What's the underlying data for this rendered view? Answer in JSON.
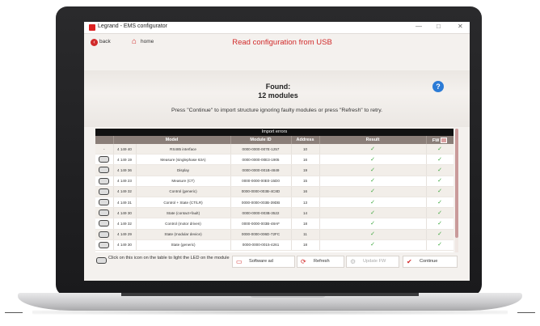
{
  "window": {
    "title": "Legrand - EMS configurator",
    "minimize": "—",
    "maximize": "□",
    "close": "✕"
  },
  "nav": {
    "back_label": "back",
    "home_label": "home",
    "page_title": "Read configuration from USB"
  },
  "found": {
    "line1": "Found:",
    "line2": "12 modules"
  },
  "instruction": "Press \"Continue\" to import structure ignoring faulty modules or press \"Refresh\" to retry.",
  "table": {
    "banner": "Import errors",
    "headers": [
      "",
      "Model",
      "Module ID",
      "Address",
      "Result",
      "FW"
    ],
    "rows": [
      {
        "led": "-",
        "ref": "4 149 40",
        "model": "RS485 interface",
        "module_id": "0000-0000-007E-1257",
        "address": "10",
        "result": "✓",
        "fw": "✓"
      },
      {
        "led": "",
        "ref": "4 149 19",
        "model": "Measure (singlephase 63A)",
        "module_id": "0000-0000-00E3-1905",
        "address": "16",
        "result": "✓",
        "fw": "✓"
      },
      {
        "led": "",
        "ref": "4 149 36",
        "model": "Display",
        "module_id": "0000-0000-001B-4849",
        "address": "19",
        "result": "✓",
        "fw": "✓"
      },
      {
        "led": "",
        "ref": "4 149 23",
        "model": "Measure (CT)",
        "module_id": "0000-0000-00E0-15D0",
        "address": "15",
        "result": "✓",
        "fw": "✓"
      },
      {
        "led": "",
        "ref": "4 149 32",
        "model": "Control (generic)",
        "module_id": "0000-0000-003B-4C8D",
        "address": "16",
        "result": "✓",
        "fw": "✓"
      },
      {
        "led": "",
        "ref": "4 149 31",
        "model": "Control + State (CT/LR)",
        "module_id": "0000-0000-003B-39DB",
        "address": "13",
        "result": "✓",
        "fw": "✓"
      },
      {
        "led": "",
        "ref": "4 149 30",
        "model": "State (contact+fault)",
        "module_id": "0000-0000-003B-3522",
        "address": "14",
        "result": "✓",
        "fw": "✓"
      },
      {
        "led": "",
        "ref": "4 149 32",
        "model": "Control (motor driven)",
        "module_id": "0000-0000-003B-48AF",
        "address": "18",
        "result": "✓",
        "fw": "✓"
      },
      {
        "led": "",
        "ref": "4 149 29",
        "model": "State (modular device)",
        "module_id": "0000-0000-006D-72FC",
        "address": "11",
        "result": "✓",
        "fw": "✓"
      },
      {
        "led": "",
        "ref": "4 149 30",
        "model": "State (generic)",
        "module_id": "0000-0000-0015-4261",
        "address": "18",
        "result": "✓",
        "fw": "✓"
      }
    ]
  },
  "footer": {
    "hint": "Click on this icon on the table to light the LED on the module",
    "software_ad": "Software ad",
    "refresh": "Refresh",
    "update_fw": "Update FW",
    "continue": "Continue"
  },
  "colors": {
    "accent": "#d12a2a",
    "check": "#3aa53a",
    "help": "#2b7bd6",
    "header": "#8a7e78"
  }
}
